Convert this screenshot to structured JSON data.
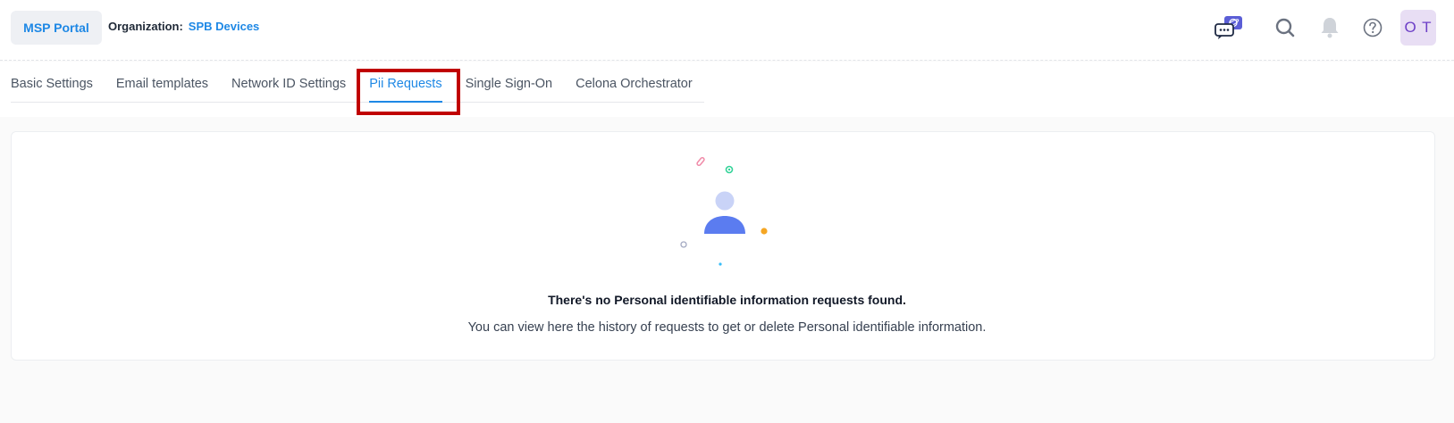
{
  "header": {
    "portal_button": "MSP Portal",
    "org_label": "Organization:",
    "org_name": "SPB Devices",
    "avatar_initials": "O T",
    "icons": [
      "chat-icon",
      "search-icon",
      "bell-icon",
      "help-icon"
    ]
  },
  "tabs": [
    {
      "label": "Basic Settings",
      "active": false
    },
    {
      "label": "Email templates",
      "active": false
    },
    {
      "label": "Network ID Settings",
      "active": false
    },
    {
      "label": "Pii Requests",
      "active": true
    },
    {
      "label": "Single Sign-On",
      "active": false
    },
    {
      "label": "Celona Orchestrator",
      "active": false
    }
  ],
  "empty_state": {
    "title": "There's no Personal identifiable information requests found.",
    "subtitle": "You can view here the history of requests to get or delete Personal identifiable information."
  },
  "colors": {
    "accent": "#1e88e5",
    "highlight": "#c00000",
    "avatar_bg": "#e8def4",
    "avatar_fg": "#6d3fc7"
  }
}
